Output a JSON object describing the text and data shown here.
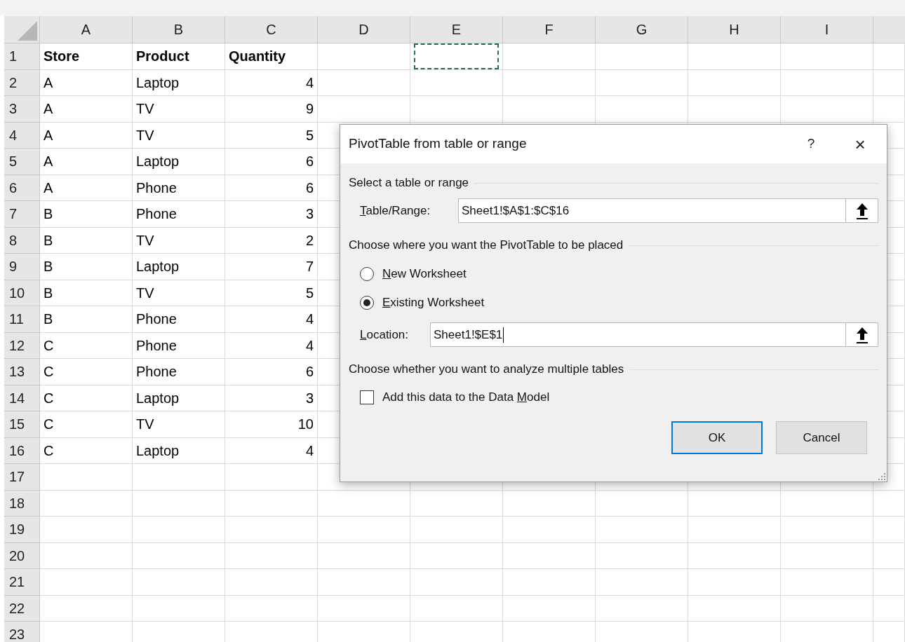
{
  "sheet": {
    "columns": [
      "A",
      "B",
      "C",
      "D",
      "E",
      "F",
      "G",
      "H",
      "I"
    ],
    "rows": [
      {
        "number": "1",
        "kind": "header",
        "cells": [
          {
            "text": "Store"
          },
          {
            "text": "Product"
          },
          {
            "text": "Quantity"
          },
          {
            "marquee": false
          },
          {
            "marquee": true
          }
        ]
      },
      {
        "number": "2",
        "kind": "data",
        "cells": [
          {
            "text": "A",
            "numeric": false
          },
          {
            "text": "Laptop",
            "numeric": false
          },
          {
            "text": "4",
            "numeric": true
          }
        ]
      },
      {
        "number": "3",
        "kind": "data",
        "cells": [
          {
            "text": "A",
            "numeric": false
          },
          {
            "text": "TV",
            "numeric": false
          },
          {
            "text": "9",
            "numeric": true
          }
        ]
      },
      {
        "number": "4",
        "kind": "data",
        "cells": [
          {
            "text": "A",
            "numeric": false
          },
          {
            "text": "TV",
            "numeric": false
          },
          {
            "text": "5",
            "numeric": true
          }
        ]
      },
      {
        "number": "5",
        "kind": "data",
        "cells": [
          {
            "text": "A",
            "numeric": false
          },
          {
            "text": "Laptop",
            "numeric": false
          },
          {
            "text": "6",
            "numeric": true
          }
        ]
      },
      {
        "number": "6",
        "kind": "data",
        "cells": [
          {
            "text": "A",
            "numeric": false
          },
          {
            "text": "Phone",
            "numeric": false
          },
          {
            "text": "6",
            "numeric": true
          }
        ]
      },
      {
        "number": "7",
        "kind": "data",
        "cells": [
          {
            "text": "B",
            "numeric": false
          },
          {
            "text": "Phone",
            "numeric": false
          },
          {
            "text": "3",
            "numeric": true
          }
        ]
      },
      {
        "number": "8",
        "kind": "data",
        "cells": [
          {
            "text": "B",
            "numeric": false
          },
          {
            "text": "TV",
            "numeric": false
          },
          {
            "text": "2",
            "numeric": true
          }
        ]
      },
      {
        "number": "9",
        "kind": "data",
        "cells": [
          {
            "text": "B",
            "numeric": false
          },
          {
            "text": "Laptop",
            "numeric": false
          },
          {
            "text": "7",
            "numeric": true
          }
        ]
      },
      {
        "number": "10",
        "kind": "data",
        "cells": [
          {
            "text": "B",
            "numeric": false
          },
          {
            "text": "TV",
            "numeric": false
          },
          {
            "text": "5",
            "numeric": true
          }
        ]
      },
      {
        "number": "11",
        "kind": "data",
        "cells": [
          {
            "text": "B",
            "numeric": false
          },
          {
            "text": "Phone",
            "numeric": false
          },
          {
            "text": "4",
            "numeric": true
          }
        ]
      },
      {
        "number": "12",
        "kind": "data",
        "cells": [
          {
            "text": "C",
            "numeric": false
          },
          {
            "text": "Phone",
            "numeric": false
          },
          {
            "text": "4",
            "numeric": true
          }
        ]
      },
      {
        "number": "13",
        "kind": "data",
        "cells": [
          {
            "text": "C",
            "numeric": false
          },
          {
            "text": "Phone",
            "numeric": false
          },
          {
            "text": "6",
            "numeric": true
          }
        ]
      },
      {
        "number": "14",
        "kind": "data",
        "cells": [
          {
            "text": "C",
            "numeric": false
          },
          {
            "text": "Laptop",
            "numeric": false
          },
          {
            "text": "3",
            "numeric": true
          }
        ]
      },
      {
        "number": "15",
        "kind": "data",
        "cells": [
          {
            "text": "C",
            "numeric": false
          },
          {
            "text": "TV",
            "numeric": false
          },
          {
            "text": "10",
            "numeric": true
          }
        ]
      },
      {
        "number": "16",
        "kind": "data",
        "cells": [
          {
            "text": "C",
            "numeric": false
          },
          {
            "text": "Laptop",
            "numeric": false
          },
          {
            "text": "4",
            "numeric": true
          }
        ]
      },
      {
        "number": "17",
        "kind": "data"
      },
      {
        "number": "18",
        "kind": "data"
      },
      {
        "number": "19",
        "kind": "data"
      },
      {
        "number": "20",
        "kind": "data"
      },
      {
        "number": "21",
        "kind": "data"
      },
      {
        "number": "22",
        "kind": "data"
      },
      {
        "number": "23",
        "kind": "data"
      }
    ]
  },
  "dialog": {
    "title": "PivotTable from table or range",
    "help": "?",
    "close": "×",
    "source": {
      "heading": "Select a table or range",
      "label": {
        "key": "T",
        "after": "able/Range:"
      },
      "value": "Sheet1!$A$1:$C$16",
      "focused": false
    },
    "placement": {
      "heading": "Choose where you want the PivotTable to be placed",
      "options": [
        {
          "label": {
            "key": "N",
            "after": "ew Worksheet"
          },
          "selected": false
        },
        {
          "label": {
            "key": "E",
            "after": "xisting Worksheet"
          },
          "selected": true
        }
      ],
      "location": {
        "label": {
          "key": "L",
          "after": "ocation:"
        },
        "value": "Sheet1!$E$1",
        "focused": true
      }
    },
    "analysis": {
      "heading": "Choose whether you want to analyze multiple tables",
      "checkbox": {
        "label": {
          "before": "Add this data to the Data ",
          "key": "M",
          "after": "odel"
        },
        "checked": false
      }
    },
    "buttons": [
      {
        "label": "OK",
        "default": true
      },
      {
        "label": "Cancel",
        "default": false
      }
    ]
  }
}
